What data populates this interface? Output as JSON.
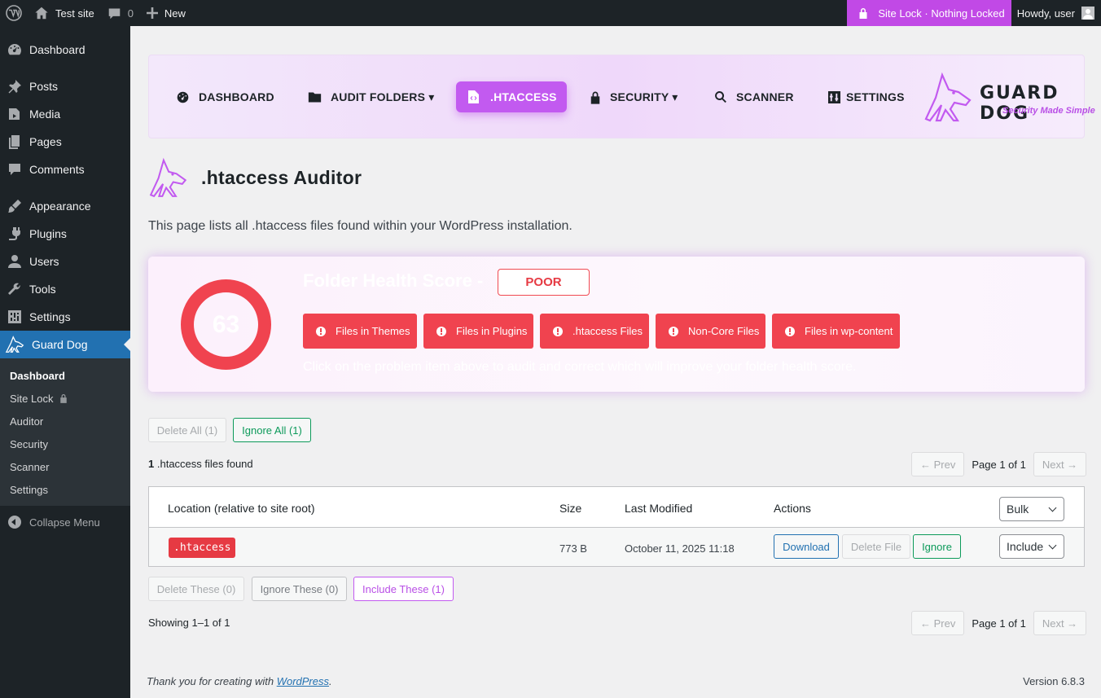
{
  "admin_bar": {
    "site_name": "Test site",
    "comments_count": "0",
    "new_label": "New",
    "site_lock": "Site Lock · Nothing Locked",
    "howdy": "Howdy, user"
  },
  "sidebar": {
    "items": [
      {
        "label": "Dashboard",
        "icon": "dashboard-icon"
      },
      {
        "label": "Posts",
        "icon": "pin-icon"
      },
      {
        "label": "Media",
        "icon": "media-icon"
      },
      {
        "label": "Pages",
        "icon": "pages-icon"
      },
      {
        "label": "Comments",
        "icon": "comments-icon"
      },
      {
        "label": "Appearance",
        "icon": "brush-icon"
      },
      {
        "label": "Plugins",
        "icon": "plug-icon"
      },
      {
        "label": "Users",
        "icon": "user-icon"
      },
      {
        "label": "Tools",
        "icon": "wrench-icon"
      },
      {
        "label": "Settings",
        "icon": "sliders-icon"
      },
      {
        "label": "Guard Dog",
        "icon": "guard-dog-icon"
      }
    ],
    "submenu": [
      "Dashboard",
      "Site Lock",
      "Auditor",
      "Security",
      "Scanner",
      "Settings"
    ],
    "collapse": "Collapse Menu"
  },
  "plugin_nav": {
    "items": [
      "DASHBOARD",
      "AUDIT FOLDERS ▾",
      ".HTACCESS",
      "SECURITY ▾",
      "SCANNER",
      "SETTINGS"
    ],
    "active": ".HTACCESS",
    "logo_text": "GUARD DOG",
    "logo_tagline": "Security Made Simple",
    "accent_color": "#c25af0"
  },
  "page": {
    "title": ".htaccess Auditor",
    "intro": "This page lists all .htaccess files found within your WordPress installation."
  },
  "health": {
    "score": "63",
    "title": "Folder Health Score -",
    "rating": "POOR",
    "issues": [
      "Files in Themes",
      "Files in Plugins",
      ".htaccess Files",
      "Non-Core Files",
      "Files in wp-content"
    ],
    "hint": "Click on the problem item above to audit and correct which will improve your folder health score.",
    "color": "#f0434f"
  },
  "bulk_top": {
    "delete_all": "Delete All (1)",
    "ignore_all": "Ignore All (1)"
  },
  "list": {
    "found_count": "1",
    "found_label": ".htaccess files found",
    "prev": "← Prev",
    "next": "Next →",
    "page_info": "Page 1 of 1",
    "columns": [
      "Location (relative to site root)",
      "Size",
      "Last Modified",
      "Actions"
    ],
    "bulk_select": "Bulk",
    "rows": [
      {
        "location": ".htaccess",
        "size": "773 B",
        "modified": "October 11, 2025 11:18",
        "download": "Download",
        "delete": "Delete File",
        "ignore": "Ignore",
        "state": "Include"
      }
    ]
  },
  "bulk_bottom": {
    "delete": "Delete These (0)",
    "ignore": "Ignore These (0)",
    "include": "Include These (1)"
  },
  "showing": "Showing 1–1 of 1",
  "footer": {
    "thanks_prefix": "Thank you for creating with",
    "thanks_link": "WordPress",
    "thanks_suffix": ".",
    "version": "Version 6.8.3"
  }
}
